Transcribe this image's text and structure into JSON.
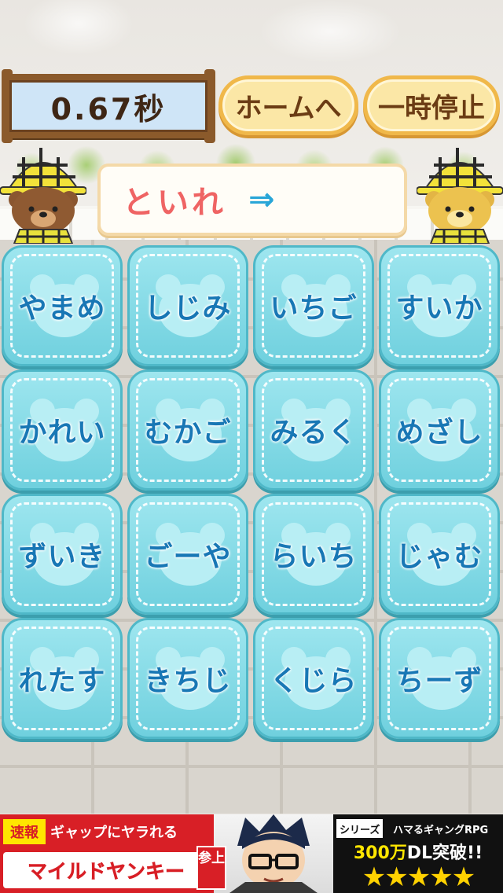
{
  "timer": {
    "value": "0.67秒"
  },
  "buttons": {
    "home": "ホームへ",
    "pause": "一時停止"
  },
  "word_chain": {
    "current": "といれ",
    "arrow": "⇒"
  },
  "tiles": [
    "やまめ",
    "しじみ",
    "いちご",
    "すいか",
    "かれい",
    "むかご",
    "みるく",
    "めざし",
    "ずいき",
    "ごーや",
    "らいち",
    "じゃむ",
    "れたす",
    "きちじ",
    "くじら",
    "ちーず"
  ],
  "ad": {
    "badge": "速報",
    "headline": "ギャップにヤラれる",
    "title": "マイルドヤンキー",
    "sanjou": "参上",
    "series_tag": "シリーズ",
    "series_name": "ハマるギャングRPG",
    "downloads_num": "300万",
    "downloads_text": "DL突破!!",
    "stars": "★★★★★"
  },
  "colors": {
    "tile": "#7fd8e4",
    "tile_text": "#1877b5",
    "word_text": "#ef6464",
    "arrow": "#29a6d8",
    "button_fill": "#fbe7a6",
    "timer_fill": "#cfe5f7",
    "ad_red": "#d81f26"
  },
  "icons": {
    "character": "bear-detective-icon",
    "tile_motif": "bear-face-icon"
  }
}
